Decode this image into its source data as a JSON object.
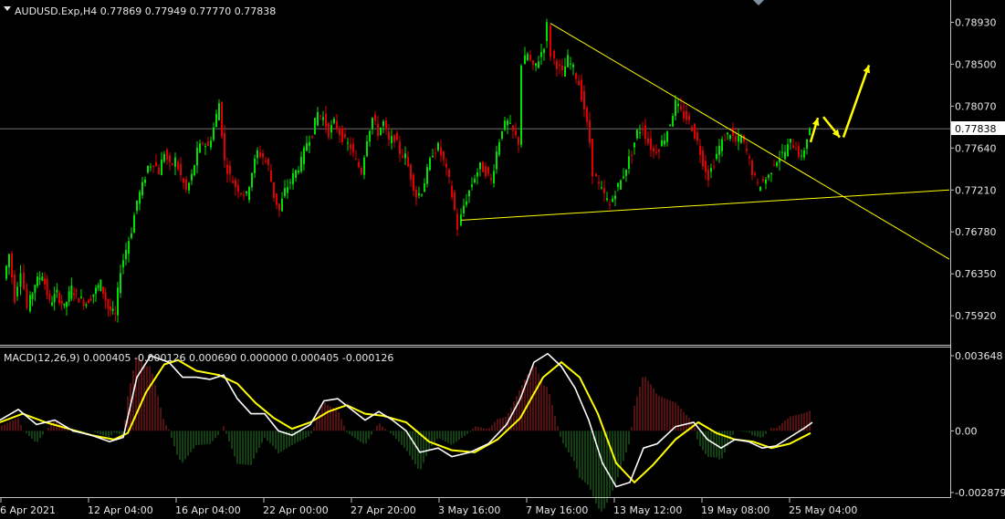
{
  "symbol_header": "AUDUSD.Exp,H4  0.77869 0.77949 0.77770 0.77838",
  "macd_header": "MACD(12,26,9) 0.000405 -0.000126 0.000690 0.000000 0.000405 -0.000126",
  "current_price": "0.77838",
  "price_axis": [
    "0.78930",
    "0.78500",
    "0.78070",
    "0.77640",
    "0.77210",
    "0.76780",
    "0.76350",
    "0.75920"
  ],
  "macd_axis": [
    "0.003648",
    "0.00",
    "-0.002879"
  ],
  "time_axis": [
    "6 Apr 2021",
    "12 Apr 04:00",
    "16 Apr 04:00",
    "22 Apr 00:00",
    "27 Apr 20:00",
    "3 May 16:00",
    "7 May 16:00",
    "13 May 12:00",
    "19 May 08:00",
    "25 May 04:00"
  ],
  "colors": {
    "background": "#000000",
    "bull": "#00e000",
    "bear": "#e00000",
    "macd_line": "#ffffff",
    "signal_line": "#ffff00",
    "hist_up": "#8b1c1c",
    "hist_down": "#1f6b1f",
    "trendline": "#ffff00",
    "arrow": "#ffff00",
    "axis_text": "#e6e6e6"
  },
  "chart_data": {
    "type": "candlestick",
    "symbol": "AUDUSD.Exp",
    "timeframe": "H4",
    "ohlc_last": {
      "open": 0.77869,
      "high": 0.77949,
      "low": 0.7777,
      "close": 0.77838
    },
    "ylim": [
      0.7565,
      0.7914
    ],
    "close_path": [
      [
        6,
        0.763
      ],
      [
        12,
        0.7655
      ],
      [
        18,
        0.761
      ],
      [
        25,
        0.764
      ],
      [
        32,
        0.76
      ],
      [
        40,
        0.7625
      ],
      [
        48,
        0.7635
      ],
      [
        56,
        0.7605
      ],
      [
        64,
        0.7615
      ],
      [
        72,
        0.76
      ],
      [
        80,
        0.762
      ],
      [
        88,
        0.761
      ],
      [
        96,
        0.7605
      ],
      [
        104,
        0.7615
      ],
      [
        112,
        0.7625
      ],
      [
        120,
        0.76
      ],
      [
        128,
        0.7592
      ],
      [
        134,
        0.764
      ],
      [
        140,
        0.766
      ],
      [
        146,
        0.768
      ],
      [
        152,
        0.771
      ],
      [
        158,
        0.7725
      ],
      [
        164,
        0.7745
      ],
      [
        170,
        0.775
      ],
      [
        176,
        0.774
      ],
      [
        182,
        0.776
      ],
      [
        188,
        0.7745
      ],
      [
        194,
        0.7752
      ],
      [
        200,
        0.7735
      ],
      [
        206,
        0.772
      ],
      [
        212,
        0.7735
      ],
      [
        218,
        0.776
      ],
      [
        224,
        0.777
      ],
      [
        230,
        0.7765
      ],
      [
        236,
        0.7785
      ],
      [
        242,
        0.781
      ],
      [
        248,
        0.775
      ],
      [
        254,
        0.7735
      ],
      [
        260,
        0.7725
      ],
      [
        266,
        0.772
      ],
      [
        272,
        0.7715
      ],
      [
        278,
        0.774
      ],
      [
        284,
        0.776
      ],
      [
        290,
        0.7755
      ],
      [
        296,
        0.7745
      ],
      [
        302,
        0.7715
      ],
      [
        308,
        0.77
      ],
      [
        314,
        0.772
      ],
      [
        320,
        0.773
      ],
      [
        326,
        0.774
      ],
      [
        332,
        0.775
      ],
      [
        338,
        0.777
      ],
      [
        344,
        0.778
      ],
      [
        350,
        0.78
      ],
      [
        356,
        0.7795
      ],
      [
        362,
        0.778
      ],
      [
        368,
        0.779
      ],
      [
        374,
        0.778
      ],
      [
        380,
        0.777
      ],
      [
        386,
        0.7765
      ],
      [
        392,
        0.775
      ],
      [
        398,
        0.774
      ],
      [
        404,
        0.7775
      ],
      [
        410,
        0.7795
      ],
      [
        416,
        0.778
      ],
      [
        422,
        0.779
      ],
      [
        428,
        0.777
      ],
      [
        434,
        0.7775
      ],
      [
        440,
        0.776
      ],
      [
        446,
        0.7755
      ],
      [
        452,
        0.7735
      ],
      [
        458,
        0.7715
      ],
      [
        464,
        0.772
      ],
      [
        470,
        0.774
      ],
      [
        476,
        0.776
      ],
      [
        482,
        0.7765
      ],
      [
        488,
        0.775
      ],
      [
        494,
        0.773
      ],
      [
        500,
        0.77
      ],
      [
        504,
        0.7682
      ],
      [
        510,
        0.7705
      ],
      [
        516,
        0.772
      ],
      [
        522,
        0.7735
      ],
      [
        528,
        0.7745
      ],
      [
        534,
        0.774
      ],
      [
        540,
        0.773
      ],
      [
        546,
        0.776
      ],
      [
        552,
        0.7785
      ],
      [
        558,
        0.779
      ],
      [
        564,
        0.778
      ],
      [
        570,
        0.777
      ],
      [
        574,
        0.785
      ],
      [
        580,
        0.786
      ],
      [
        586,
        0.7845
      ],
      [
        592,
        0.7855
      ],
      [
        598,
        0.787
      ],
      [
        602,
        0.789
      ],
      [
        606,
        0.786
      ],
      [
        612,
        0.785
      ],
      [
        618,
        0.784
      ],
      [
        624,
        0.7855
      ],
      [
        630,
        0.7845
      ],
      [
        636,
        0.783
      ],
      [
        642,
        0.7805
      ],
      [
        648,
        0.777
      ],
      [
        652,
        0.774
      ],
      [
        658,
        0.7725
      ],
      [
        664,
        0.7715
      ],
      [
        670,
        0.7705
      ],
      [
        676,
        0.772
      ],
      [
        682,
        0.773
      ],
      [
        688,
        0.7745
      ],
      [
        694,
        0.776
      ],
      [
        700,
        0.778
      ],
      [
        706,
        0.7785
      ],
      [
        712,
        0.777
      ],
      [
        718,
        0.776
      ],
      [
        724,
        0.7765
      ],
      [
        730,
        0.7775
      ],
      [
        736,
        0.779
      ],
      [
        742,
        0.781
      ],
      [
        748,
        0.78
      ],
      [
        754,
        0.7795
      ],
      [
        760,
        0.7785
      ],
      [
        766,
        0.777
      ],
      [
        772,
        0.775
      ],
      [
        778,
        0.7735
      ],
      [
        784,
        0.775
      ],
      [
        790,
        0.7765
      ],
      [
        796,
        0.7775
      ],
      [
        802,
        0.778
      ],
      [
        808,
        0.777
      ],
      [
        814,
        0.7775
      ],
      [
        820,
        0.776
      ],
      [
        826,
        0.774
      ],
      [
        832,
        0.7725
      ],
      [
        838,
        0.773
      ],
      [
        844,
        0.7735
      ],
      [
        850,
        0.775
      ],
      [
        856,
        0.7755
      ],
      [
        862,
        0.776
      ],
      [
        868,
        0.777
      ],
      [
        874,
        0.7765
      ],
      [
        880,
        0.7752
      ],
      [
        886,
        0.7775
      ],
      [
        890,
        0.7784
      ]
    ],
    "trendlines": [
      {
        "x1": 603,
        "y1": 0.7892,
        "x2": 1040,
        "y2": 0.765
      },
      {
        "x1": 505,
        "y1": 0.769,
        "x2": 1040,
        "y2": 0.7721
      }
    ],
    "horizontal_line": 0.77838,
    "projection_arrows": [
      [
        [
          888,
          0.777
        ],
        [
          896,
          0.7795
        ]
      ],
      [
        [
          902,
          0.7796
        ],
        [
          920,
          0.7775
        ]
      ],
      [
        [
          924,
          0.7775
        ],
        [
          952,
          0.7849
        ]
      ]
    ],
    "macd": {
      "ylim": [
        -0.003,
        0.0038
      ],
      "macd_path": [
        [
          0,
          0.0005
        ],
        [
          20,
          0.001
        ],
        [
          40,
          0.0003
        ],
        [
          60,
          0.0005
        ],
        [
          80,
          0.0
        ],
        [
          100,
          -0.0002
        ],
        [
          120,
          -0.0005
        ],
        [
          135,
          -0.0003
        ],
        [
          150,
          0.0025
        ],
        [
          165,
          0.0035
        ],
        [
          185,
          0.0032
        ],
        [
          200,
          0.0025
        ],
        [
          215,
          0.0025
        ],
        [
          230,
          0.0024
        ],
        [
          245,
          0.0026
        ],
        [
          260,
          0.0015
        ],
        [
          275,
          0.0008
        ],
        [
          290,
          0.0008
        ],
        [
          305,
          0.0
        ],
        [
          320,
          -0.0002
        ],
        [
          340,
          0.0003
        ],
        [
          355,
          0.0014
        ],
        [
          370,
          0.0015
        ],
        [
          385,
          0.001
        ],
        [
          400,
          0.0005
        ],
        [
          415,
          0.0009
        ],
        [
          430,
          0.0005
        ],
        [
          445,
          0.0
        ],
        [
          460,
          -0.001
        ],
        [
          480,
          -0.0008
        ],
        [
          495,
          -0.0012
        ],
        [
          515,
          -0.001
        ],
        [
          535,
          -0.0006
        ],
        [
          555,
          0.0003
        ],
        [
          570,
          0.0015
        ],
        [
          585,
          0.0032
        ],
        [
          600,
          0.0036
        ],
        [
          615,
          0.003
        ],
        [
          630,
          0.002
        ],
        [
          645,
          0.0005
        ],
        [
          660,
          -0.0015
        ],
        [
          675,
          -0.0026
        ],
        [
          690,
          -0.0024
        ],
        [
          705,
          -0.0008
        ],
        [
          720,
          -0.0006
        ],
        [
          740,
          0.0002
        ],
        [
          760,
          0.0004
        ],
        [
          775,
          -0.0004
        ],
        [
          790,
          -0.0008
        ],
        [
          805,
          -0.0004
        ],
        [
          820,
          -0.0005
        ],
        [
          835,
          -0.0008
        ],
        [
          850,
          -0.0007
        ],
        [
          865,
          -0.0003
        ],
        [
          880,
          0.0001
        ],
        [
          890,
          0.0004
        ]
      ],
      "signal_path": [
        [
          0,
          0.0004
        ],
        [
          25,
          0.0008
        ],
        [
          50,
          0.0004
        ],
        [
          75,
          0.0001
        ],
        [
          100,
          -0.0002
        ],
        [
          125,
          -0.0004
        ],
        [
          140,
          -0.0001
        ],
        [
          160,
          0.0018
        ],
        [
          180,
          0.0031
        ],
        [
          195,
          0.0033
        ],
        [
          215,
          0.0028
        ],
        [
          240,
          0.0026
        ],
        [
          260,
          0.0022
        ],
        [
          280,
          0.0013
        ],
        [
          300,
          0.0006
        ],
        [
          320,
          0.0001
        ],
        [
          340,
          0.0004
        ],
        [
          360,
          0.0009
        ],
        [
          380,
          0.0012
        ],
        [
          400,
          0.0008
        ],
        [
          420,
          0.0007
        ],
        [
          445,
          0.0004
        ],
        [
          470,
          -0.0005
        ],
        [
          495,
          -0.0009
        ],
        [
          520,
          -0.001
        ],
        [
          545,
          -0.0004
        ],
        [
          570,
          0.0006
        ],
        [
          595,
          0.0025
        ],
        [
          615,
          0.0032
        ],
        [
          635,
          0.0025
        ],
        [
          655,
          0.0008
        ],
        [
          675,
          -0.0015
        ],
        [
          695,
          -0.0024
        ],
        [
          715,
          -0.0016
        ],
        [
          740,
          -0.0004
        ],
        [
          765,
          0.0004
        ],
        [
          785,
          -0.0001
        ],
        [
          805,
          -0.0004
        ],
        [
          825,
          -0.0005
        ],
        [
          845,
          -0.0008
        ],
        [
          865,
          -0.0006
        ],
        [
          888,
          -0.0001
        ]
      ]
    }
  }
}
